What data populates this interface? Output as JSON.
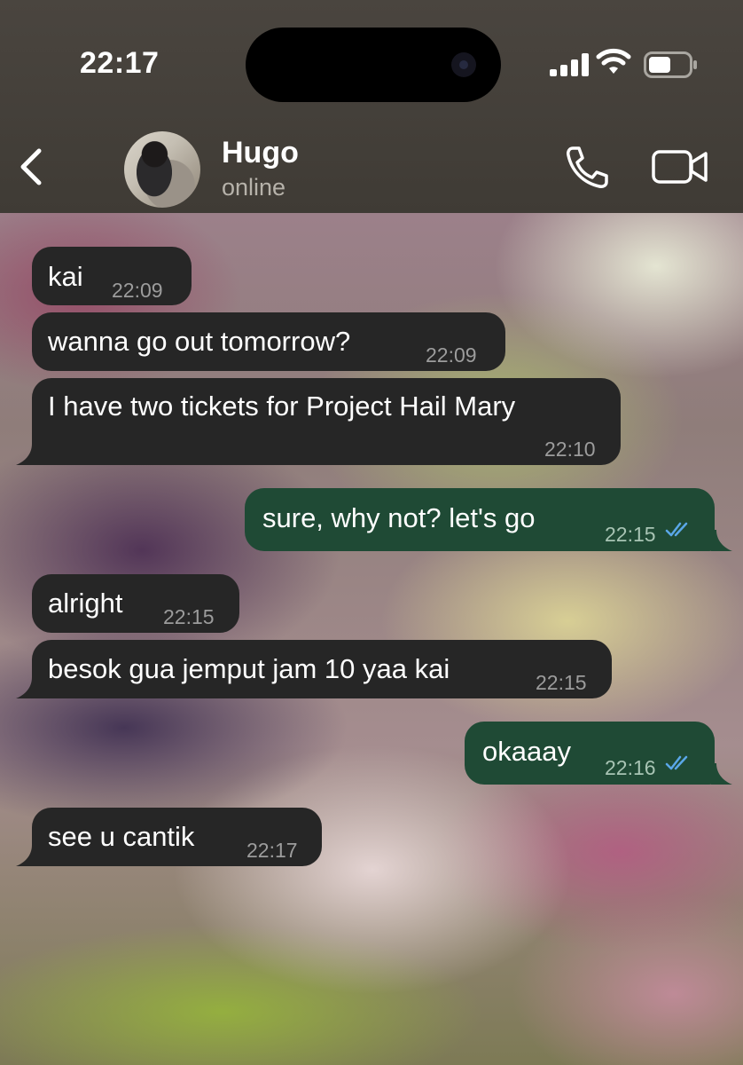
{
  "status_bar": {
    "time": "22:17"
  },
  "header": {
    "contact_name": "Hugo",
    "contact_status": "online"
  },
  "messages": [
    {
      "direction": "in",
      "text": "kai",
      "time": "22:09"
    },
    {
      "direction": "in",
      "text": "wanna go out tomorrow?",
      "time": "22:09"
    },
    {
      "direction": "in",
      "text": "I have two tickets for Project Hail Mary",
      "time": "22:10"
    },
    {
      "direction": "out",
      "text": "sure, why not? let's go",
      "time": "22:15",
      "status": "read"
    },
    {
      "direction": "in",
      "text": "alright",
      "time": "22:15"
    },
    {
      "direction": "in",
      "text": "besok gua jemput jam 10 yaa kai",
      "time": "22:15"
    },
    {
      "direction": "out",
      "text": "okaaay",
      "time": "22:16",
      "status": "read"
    },
    {
      "direction": "in",
      "text": "see u cantik",
      "time": "22:17"
    }
  ],
  "colors": {
    "incoming_bubble": "#262626",
    "outgoing_bubble": "#1f4a35",
    "read_ticks": "#5aa7e8",
    "header_bg": "#423e38"
  },
  "icons": [
    "back-chevron-icon",
    "phone-icon",
    "video-camera-icon",
    "signal-icon",
    "wifi-icon",
    "battery-icon",
    "double-check-icon"
  ]
}
